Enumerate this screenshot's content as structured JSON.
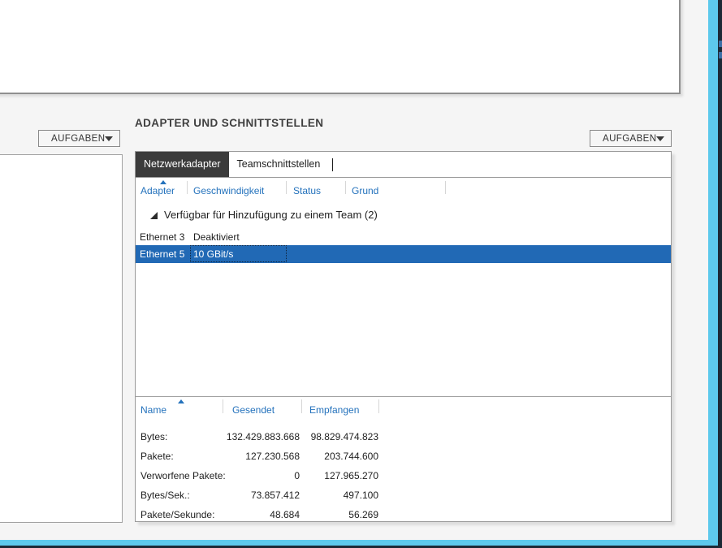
{
  "section": {
    "title": "ADAPTER UND SCHNITTSTELLEN"
  },
  "tasks_left": {
    "label": "AUFGABEN"
  },
  "tasks_right": {
    "label": "AUFGABEN"
  },
  "tabs": {
    "network_adapters": "Netzwerkadapter",
    "team_interfaces": "Teamschnittstellen"
  },
  "adapter_table": {
    "headers": {
      "adapter": "Adapter",
      "speed": "Geschwindigkeit",
      "status": "Status",
      "reason": "Grund"
    },
    "sort_column": "Adapter",
    "sort_direction": "ascending",
    "group_label": "Verfügbar für Hinzufügung zu einem Team (2)",
    "group_expanded": true,
    "rows": [
      {
        "adapter": "Ethernet 3",
        "speed": "Deaktiviert",
        "status": "",
        "reason": "",
        "selected": false
      },
      {
        "adapter": "Ethernet 5",
        "speed": "10 GBit/s",
        "status": "",
        "reason": "",
        "selected": true
      }
    ]
  },
  "stats_table": {
    "headers": {
      "name": "Name",
      "sent": "Gesendet",
      "received": "Empfangen"
    },
    "sort_column": "Name",
    "sort_direction": "ascending",
    "rows": [
      {
        "name": "Bytes:",
        "sent": "132.429.883.668",
        "received": "98.829.474.823"
      },
      {
        "name": "Pakete:",
        "sent": "127.230.568",
        "received": "203.744.600"
      },
      {
        "name": "Verworfene Pakete:",
        "sent": "0",
        "received": "127.965.270"
      },
      {
        "name": "Bytes/Sek.:",
        "sent": "73.857.412",
        "received": "497.100"
      },
      {
        "name": "Pakete/Sekunde:",
        "sent": "48.684",
        "received": "56.269"
      }
    ]
  },
  "colors": {
    "accent_link_blue": "#2472bc",
    "selection_blue": "#2169b5",
    "selected_tab_bg": "#3b3b3b",
    "window_border_cyan": "#5dc9ec",
    "outer_edge_dark": "#1c2935"
  }
}
